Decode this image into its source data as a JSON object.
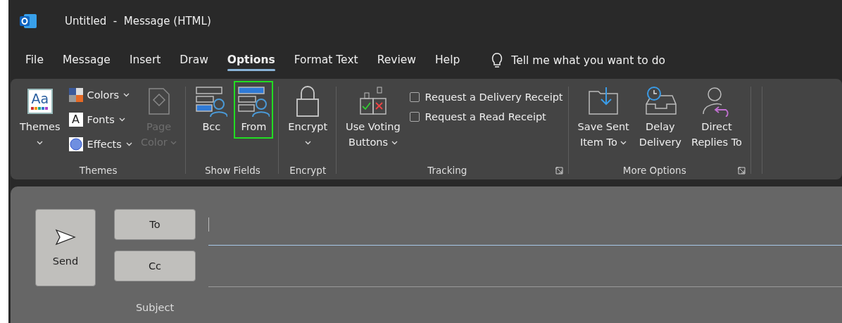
{
  "window": {
    "title": "Untitled  -  Message (HTML)"
  },
  "tabs": [
    {
      "label": "File",
      "selected": false
    },
    {
      "label": "Message",
      "selected": false
    },
    {
      "label": "Insert",
      "selected": false
    },
    {
      "label": "Draw",
      "selected": false
    },
    {
      "label": "Options",
      "selected": true
    },
    {
      "label": "Format Text",
      "selected": false
    },
    {
      "label": "Review",
      "selected": false
    },
    {
      "label": "Help",
      "selected": false
    }
  ],
  "tell_me": {
    "placeholder": "Tell me what you want to do"
  },
  "ribbon": {
    "groups": [
      {
        "label": "Themes",
        "launcher": false,
        "items": [
          {
            "kind": "large",
            "icon_text": "Aa",
            "lines": [
              "Themes"
            ],
            "menu": true,
            "disabled": false,
            "highlighted": false
          },
          {
            "kind": "stack",
            "items": [
              {
                "label": "Colors"
              },
              {
                "icon_text": "A",
                "label": "Fonts"
              },
              {
                "label": "Effects"
              }
            ]
          },
          {
            "kind": "large",
            "lines": [
              "Page",
              "Color"
            ],
            "menu": true,
            "disabled": true,
            "highlighted": false
          }
        ]
      },
      {
        "label": "Show Fields",
        "launcher": false,
        "items": [
          {
            "kind": "large",
            "lines": [
              "Bcc"
            ],
            "menu": false,
            "disabled": false,
            "highlighted": false
          },
          {
            "kind": "large",
            "lines": [
              "From"
            ],
            "menu": false,
            "disabled": false,
            "highlighted": true
          }
        ]
      },
      {
        "label": "Encrypt",
        "launcher": false,
        "items": [
          {
            "kind": "large",
            "lines": [
              "Encrypt"
            ],
            "menu": true,
            "disabled": false,
            "highlighted": false
          }
        ]
      },
      {
        "label": "Tracking",
        "launcher": true,
        "items": [
          {
            "kind": "large",
            "lines": [
              "Use Voting",
              "Buttons"
            ],
            "menu": true,
            "disabled": false,
            "highlighted": false
          },
          {
            "kind": "checklist",
            "items": [
              {
                "label": "Request a Delivery Receipt",
                "checked": false
              },
              {
                "label": "Request a Read Receipt",
                "checked": false
              }
            ]
          }
        ]
      },
      {
        "label": "More Options",
        "launcher": true,
        "items": [
          {
            "kind": "large",
            "lines": [
              "Save Sent",
              "Item To"
            ],
            "menu": true,
            "disabled": false,
            "highlighted": false
          },
          {
            "kind": "large",
            "lines": [
              "Delay",
              "Delivery"
            ],
            "menu": false,
            "disabled": false,
            "highlighted": false
          },
          {
            "kind": "large",
            "lines": [
              "Direct",
              "Replies To"
            ],
            "menu": false,
            "disabled": false,
            "highlighted": false
          }
        ]
      }
    ]
  },
  "compose": {
    "send": {
      "label": "Send"
    },
    "fields": [
      {
        "label": "To",
        "focused": true
      },
      {
        "label": "Cc",
        "focused": false
      }
    ],
    "subject": {
      "label": "Subject"
    }
  }
}
